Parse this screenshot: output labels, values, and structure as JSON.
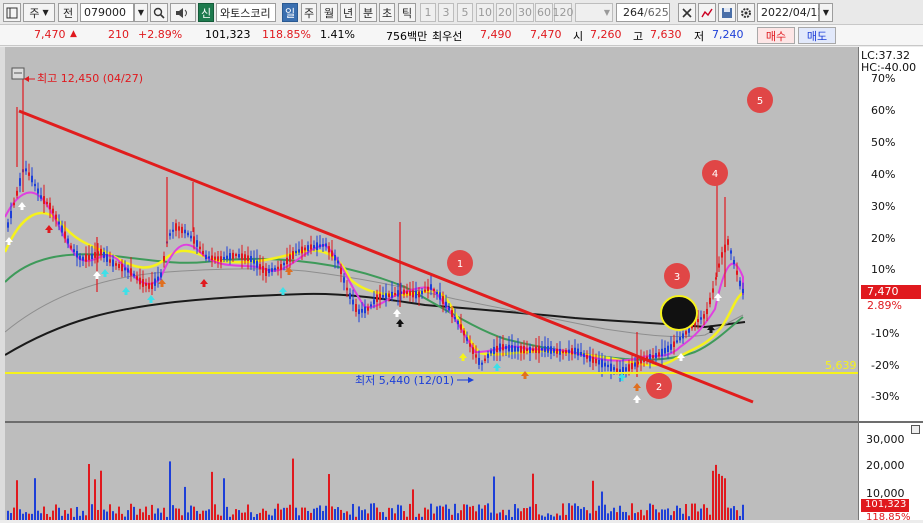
{
  "toolbar": {
    "market": "주",
    "prev_label": "전",
    "code": "079000",
    "sin_label": "신",
    "name": "와토스코리",
    "periods": [
      "일",
      "주",
      "월",
      "년",
      "분",
      "초",
      "틱"
    ],
    "numbers": [
      "1",
      "3",
      "5",
      "10",
      "20",
      "30",
      "60",
      "120"
    ],
    "count": "264",
    "total": "/625",
    "date": "2022/04/11"
  },
  "quote": {
    "price": "7,470",
    "change": "210",
    "change_pct": "+2.89%",
    "volume": "101,323",
    "volume_ratio": "118.85%",
    "turnover": "1.41%",
    "amount": "756백만",
    "best_label": "최우선",
    "best_ask": "7,490",
    "best_bid": "7,470",
    "open_label": "시",
    "open": "7,260",
    "high_label": "고",
    "high": "7,630",
    "low_label": "저",
    "low": "7,240",
    "buy_label": "매수",
    "sell_label": "매도"
  },
  "annotations": {
    "high_text": "최고 12,450 (04/27)",
    "low_text": "최저 5,440 (12/01)",
    "level_line": "5,639",
    "circles": [
      "1",
      "2",
      "3",
      "4",
      "5"
    ]
  },
  "axis": {
    "lc": "LC:37.32",
    "hc": "HC:-40.00",
    "pct_ticks": [
      "70%",
      "60%",
      "50%",
      "40%",
      "30%",
      "20%",
      "10%",
      "0%",
      "-10%",
      "-20%",
      "-30%"
    ],
    "current_price": "7,470",
    "current_pct": "2.89%",
    "vol_ticks": [
      "30,000",
      "20,000",
      "10,000"
    ],
    "current_vol": "101,323",
    "current_vol_pct": "118.85%"
  },
  "colors": {
    "up": "#e0191e",
    "down": "#1d3fd8",
    "trendline": "#e11d1d",
    "ma5": "#e040e0",
    "ma20": "#f5f21c",
    "ma60": "#3e9a5a",
    "ma120": "#909090",
    "ma240": "#1a1a1a",
    "circle": "#e04646"
  }
}
